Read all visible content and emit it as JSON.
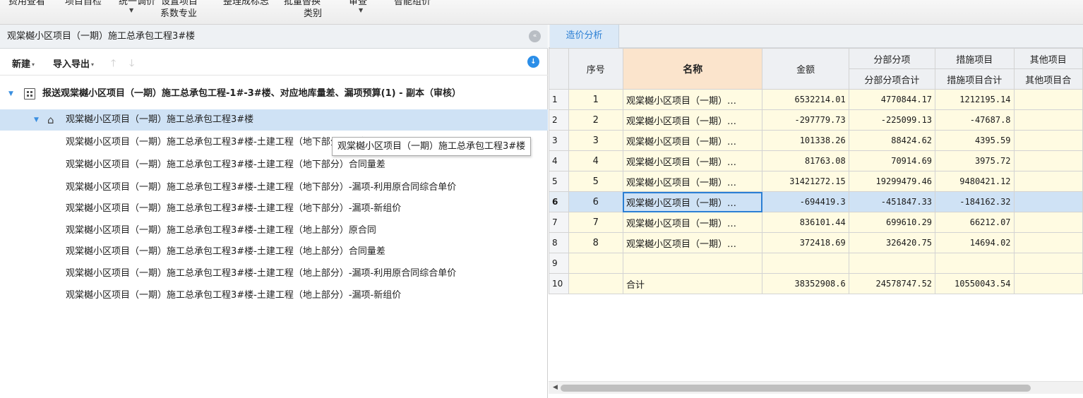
{
  "ribbon": {
    "cut_labels": [
      "费用查看",
      "项目自检",
      "统一调价",
      "设置项目",
      "整理成标志",
      "批量替换",
      "审查",
      "智能组价"
    ],
    "labels_line2": [
      "系数专业",
      "类别"
    ]
  },
  "left_panel": {
    "title": "观棠樾小区项目（一期）施工总承包工程3#楼",
    "toolbar": {
      "new_label": "新建",
      "import_export_label": "导入导出"
    },
    "tree": [
      {
        "label": "报送观棠樾小区项目（一期）施工总承包工程-1#-3#楼、对应地库量差、漏项预算(1) - 副本（审核）",
        "level": 0
      },
      {
        "label": "观棠樾小区项目（一期）施工总承包工程3#楼",
        "level": 1
      },
      {
        "label": "观棠樾小区项目（一期）施工总承包工程3#楼-土建工程（地下部分）原合同",
        "level": 2
      },
      {
        "label": "观棠樾小区项目（一期）施工总承包工程3#楼-土建工程（地下部分）合同量差",
        "level": 2
      },
      {
        "label": "观棠樾小区项目（一期）施工总承包工程3#楼-土建工程（地下部分）-漏项-利用原合同综合单价",
        "level": 2
      },
      {
        "label": "观棠樾小区项目（一期）施工总承包工程3#楼-土建工程（地下部分）-漏项-新组价",
        "level": 2
      },
      {
        "label": "观棠樾小区项目（一期）施工总承包工程3#楼-土建工程（地上部分）原合同",
        "level": 2
      },
      {
        "label": "观棠樾小区项目（一期）施工总承包工程3#楼-土建工程（地上部分）合同量差",
        "level": 2
      },
      {
        "label": "观棠樾小区项目（一期）施工总承包工程3#楼-土建工程（地上部分）-漏项-利用原合同综合单价",
        "level": 2
      },
      {
        "label": "观棠樾小区项目（一期）施工总承包工程3#楼-土建工程（地上部分）-漏项-新组价",
        "level": 2
      }
    ],
    "tooltip": "观棠樾小区项目（一期）施工总承包工程3#楼"
  },
  "right_panel": {
    "tab_label": "造价分析",
    "headers": {
      "seq": "序号",
      "name": "名称",
      "amount": "金额",
      "sub_group": "分部分项",
      "sub_total": "分部分项合计",
      "measure_group": "措施项目",
      "measure_total": "措施项目合计",
      "other_group": "其他项目",
      "other_total": "其他项目合"
    },
    "rows": [
      {
        "rownum": "1",
        "seq": "1",
        "name": "观棠樾小区项目（一期）…",
        "amount": "6532214.01",
        "sub_total": "4770844.17",
        "measure_total": "1212195.14"
      },
      {
        "rownum": "2",
        "seq": "2",
        "name": "观棠樾小区项目（一期）…",
        "amount": "-297779.73",
        "sub_total": "-225099.13",
        "measure_total": "-47687.8"
      },
      {
        "rownum": "3",
        "seq": "3",
        "name": "观棠樾小区项目（一期）…",
        "amount": "101338.26",
        "sub_total": "88424.62",
        "measure_total": "4395.59"
      },
      {
        "rownum": "4",
        "seq": "4",
        "name": "观棠樾小区项目（一期）…",
        "amount": "81763.08",
        "sub_total": "70914.69",
        "measure_total": "3975.72"
      },
      {
        "rownum": "5",
        "seq": "5",
        "name": "观棠樾小区项目（一期）…",
        "amount": "31421272.15",
        "sub_total": "19299479.46",
        "measure_total": "9480421.12"
      },
      {
        "rownum": "6",
        "seq": "6",
        "name": "观棠樾小区项目（一期）…",
        "amount": "-694419.3",
        "sub_total": "-451847.33",
        "measure_total": "-184162.32"
      },
      {
        "rownum": "7",
        "seq": "7",
        "name": "观棠樾小区项目（一期）…",
        "amount": "836101.44",
        "sub_total": "699610.29",
        "measure_total": "66212.07"
      },
      {
        "rownum": "8",
        "seq": "8",
        "name": "观棠樾小区项目（一期）…",
        "amount": "372418.69",
        "sub_total": "326420.75",
        "measure_total": "14694.02"
      },
      {
        "rownum": "9",
        "seq": "",
        "name": "",
        "amount": "",
        "sub_total": "",
        "measure_total": ""
      },
      {
        "rownum": "10",
        "seq": "",
        "name": "合计",
        "amount": "38352908.6",
        "sub_total": "24578747.52",
        "measure_total": "10550043.54"
      }
    ],
    "selected_row": 6
  },
  "colors": {
    "accent": "#2b7fd4",
    "selection": "#cfe2f5",
    "cell_bg": "#fffbe2",
    "name_header_bg": "#fbe4cc"
  }
}
